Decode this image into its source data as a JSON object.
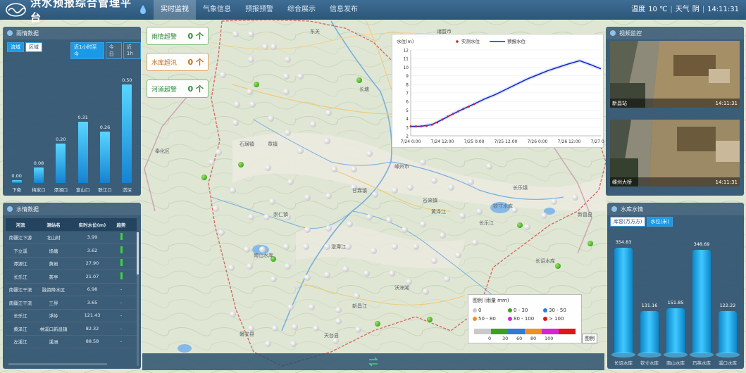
{
  "app": {
    "title": "洪水预报综合管理平台"
  },
  "nav": {
    "items": [
      "实时监视",
      "气象信息",
      "预报预警",
      "综合展示",
      "信息发布"
    ],
    "active_index": 0
  },
  "status": {
    "temperature_label": "温度",
    "temperature": "10 ℃",
    "weather_label": "天气",
    "weather": "阴",
    "time": "14:11:31"
  },
  "rain_panel": {
    "title": "雨情数据",
    "tabs": [
      "流域",
      "区域"
    ],
    "active_tab": 0,
    "time_filters": [
      "近1小时至今",
      "今日",
      "近1h"
    ],
    "bars": [
      {
        "label": "下斋",
        "value": 0.0,
        "display": "0.00"
      },
      {
        "label": "梅家口",
        "value": 0.08,
        "display": "0.08"
      },
      {
        "label": "潭湖口",
        "value": 0.2,
        "display": "0.20"
      },
      {
        "label": "富山口",
        "value": 0.31,
        "display": "0.31"
      },
      {
        "label": "联江口",
        "value": 0.26,
        "display": "0.26"
      },
      {
        "label": "淇深",
        "value": 0.5,
        "display": "0.50"
      }
    ],
    "max": 0.5
  },
  "water_panel": {
    "title": "水情数据",
    "columns": [
      "河流",
      "测站名",
      "实时水位(m)",
      "趋势"
    ],
    "rows": [
      {
        "river": "南疆江下游",
        "station": "北山村",
        "level": "3.99",
        "trend": "up"
      },
      {
        "river": "下立溪",
        "station": "场塘",
        "level": "3.62",
        "trend": "up"
      },
      {
        "river": "潭源江",
        "station": "黄岩",
        "level": "27.90",
        "trend": "up"
      },
      {
        "river": "长乐江",
        "station": "茶亭",
        "level": "21.07",
        "trend": "up"
      },
      {
        "river": "南疆江干流",
        "station": "融资降水区",
        "level": "6.98",
        "trend": "-"
      },
      {
        "river": "南疆江干流",
        "station": "三界",
        "level": "3.65",
        "trend": "-"
      },
      {
        "river": "长乐江",
        "station": "浮岭",
        "level": "121.43",
        "trend": "-"
      },
      {
        "river": "黄泽江",
        "station": "林溪口新昌镇",
        "level": "82.32",
        "trend": "-"
      },
      {
        "river": "左溪江",
        "station": "溪洲",
        "level": "88.58",
        "trend": "-"
      }
    ]
  },
  "alerts": [
    {
      "label": "雨情超警",
      "count": "0 个",
      "color": "#2f8a3b",
      "border": "#7cc07c"
    },
    {
      "label": "水库超汛",
      "count": "0 个",
      "color": "#c46b1b",
      "border": "#e0a060"
    },
    {
      "label": "河道超警",
      "count": "0 个",
      "color": "#2f8a3b",
      "border": "#7cc07c"
    }
  ],
  "chart_data": {
    "type": "line",
    "ylabel": "水位(m)",
    "ylim": [
      2,
      12
    ],
    "yticks": [
      2,
      3,
      4,
      5,
      6,
      7,
      8,
      9,
      10,
      11,
      12
    ],
    "xticks": [
      "7/24 0:00",
      "7/24 12:00",
      "7/25 0:00",
      "7/25 12:00",
      "7/26 0:00",
      "7/26 12:00",
      "7/27 0:00"
    ],
    "xlim": [
      0,
      72
    ],
    "series": [
      {
        "name": "实测水位",
        "color": "#d21f1f",
        "x": [
          0,
          2,
          4,
          6,
          8,
          10,
          12,
          14,
          16,
          18,
          20,
          22,
          24
        ],
        "y": [
          3.1,
          3.1,
          3.12,
          3.15,
          3.3,
          3.55,
          3.9,
          4.25,
          4.55,
          4.85,
          5.15,
          5.4,
          5.7
        ]
      },
      {
        "name": "预报水位",
        "color": "#1525c8",
        "x": [
          0,
          4,
          8,
          12,
          16,
          20,
          24,
          28,
          32,
          36,
          40,
          44,
          48,
          52,
          56,
          60,
          64,
          68,
          72
        ],
        "y": [
          3.1,
          3.12,
          3.3,
          3.9,
          4.55,
          5.15,
          5.7,
          6.3,
          6.8,
          7.4,
          8.0,
          8.6,
          9.1,
          9.6,
          10.0,
          10.4,
          10.75,
          10.3,
          9.8
        ]
      }
    ]
  },
  "video_panel": {
    "title": "视频监控",
    "feeds": [
      {
        "name": "新昌站",
        "time": "14:11:31"
      },
      {
        "name": "嵊州大桥",
        "time": "14:11:31"
      }
    ]
  },
  "res_panel": {
    "title": "水库水情",
    "tabs": [
      "库容(万方方)",
      "水位(米)"
    ],
    "active_tab": 1,
    "tanks": [
      {
        "name": "长诏水库",
        "value": 354.83,
        "display": "354.83"
      },
      {
        "name": "钦寸水库",
        "value": 131.16,
        "display": "131.16"
      },
      {
        "name": "南山水库",
        "value": 151.85,
        "display": "151.85"
      },
      {
        "name": "巧英水库",
        "value": 348.69,
        "display": "348.69"
      },
      {
        "name": "溪口水库",
        "value": 122.22,
        "display": "122.22"
      }
    ]
  },
  "legend": {
    "title": "图例 (雨量 mm)",
    "items": [
      {
        "label": "0",
        "color": "#c9c9c9"
      },
      {
        "label": "0 - 30",
        "color": "#3ca11d"
      },
      {
        "label": "30 - 50",
        "color": "#2e7ad9"
      },
      {
        "label": "50 - 80",
        "color": "#f0901e"
      },
      {
        "label": "80 - 100",
        "color": "#d822d8"
      },
      {
        "label": "> 100",
        "color": "#e01515"
      }
    ],
    "scale_colors": [
      "#c9c9c9",
      "#3ca11d",
      "#2e7ad9",
      "#f0901e",
      "#d822d8",
      "#e01515"
    ],
    "scale_ticks": [
      "0",
      "30",
      "60",
      "80",
      "100"
    ],
    "toggle_label": "图例"
  },
  "map_labels": [
    "东关",
    "章镇",
    "长塘",
    "嵊州市",
    "甘霖镇",
    "石璜镇",
    "崇仁镇",
    "谷来镇",
    "长乐镇",
    "新昌县",
    "澄潭江",
    "黄泽江",
    "长乐江",
    "新昌江",
    "南山水库",
    "钦寸水库",
    "长诏水库",
    "沃洲湖",
    "天台县",
    "磐安县",
    "诸暨市",
    "上虞区",
    "东阳市",
    "奉化区"
  ],
  "colors": {
    "panel": "#264a6a",
    "accent": "#1a9ae6",
    "topbar": "#335f86"
  }
}
